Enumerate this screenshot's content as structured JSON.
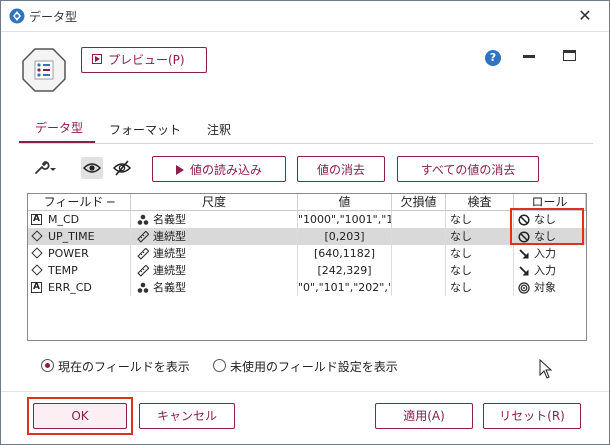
{
  "window": {
    "title": "データ型",
    "close": "✕"
  },
  "toolbar": {
    "preview_label": "プレビュー(P)",
    "help": "?"
  },
  "tabs": [
    {
      "label": "データ型",
      "active": true
    },
    {
      "label": "フォーマット",
      "active": false
    },
    {
      "label": "注釈",
      "active": false
    }
  ],
  "actions": {
    "read_values": "値の読み込み",
    "clear_values": "値の消去",
    "clear_all_values": "すべての値の消去"
  },
  "table": {
    "headers": {
      "field": "フィールド ─",
      "measure": "尺度",
      "values": "値",
      "missing": "欠損値",
      "check": "検査",
      "role": "ロール"
    },
    "rows": [
      {
        "type_icon": "string-icon",
        "field": "M_CD",
        "measure_icon": "nominal-icon",
        "measure": "名義型",
        "values": "\"1000\",\"1001\",\"1...",
        "missing": "",
        "check": "なし",
        "role_icon": "none-role-icon",
        "role": "なし",
        "selected": false
      },
      {
        "type_icon": "real-icon",
        "field": "UP_TIME",
        "measure_icon": "continuous-icon",
        "measure": "連続型",
        "values": "[0,203]",
        "missing": "",
        "check": "なし",
        "role_icon": "none-role-icon",
        "role": "なし",
        "selected": true
      },
      {
        "type_icon": "real-icon",
        "field": "POWER",
        "measure_icon": "continuous-icon",
        "measure": "連続型",
        "values": "[640,1182]",
        "missing": "",
        "check": "なし",
        "role_icon": "input-role-icon",
        "role": "入力",
        "selected": false
      },
      {
        "type_icon": "real-icon",
        "field": "TEMP",
        "measure_icon": "continuous-icon",
        "measure": "連続型",
        "values": "[242,329]",
        "missing": "",
        "check": "なし",
        "role_icon": "input-role-icon",
        "role": "入力",
        "selected": false
      },
      {
        "type_icon": "string-icon",
        "field": "ERR_CD",
        "measure_icon": "nominal-icon",
        "measure": "名義型",
        "values": "\"0\",\"101\",\"202\",\"...",
        "missing": "",
        "check": "なし",
        "role_icon": "target-role-icon",
        "role": "対象",
        "selected": false
      }
    ]
  },
  "options": {
    "show_current": "現在のフィールドを表示",
    "show_unused": "未使用のフィールド設定を表示",
    "selected": "show_current"
  },
  "footer": {
    "ok": "OK",
    "cancel": "キャンセル",
    "apply": "適用(A)",
    "reset": "リセット(R)"
  },
  "colors": {
    "accent": "#8a1f4b",
    "highlight": "#e0301e",
    "selected_row": "#d9d9d9"
  }
}
